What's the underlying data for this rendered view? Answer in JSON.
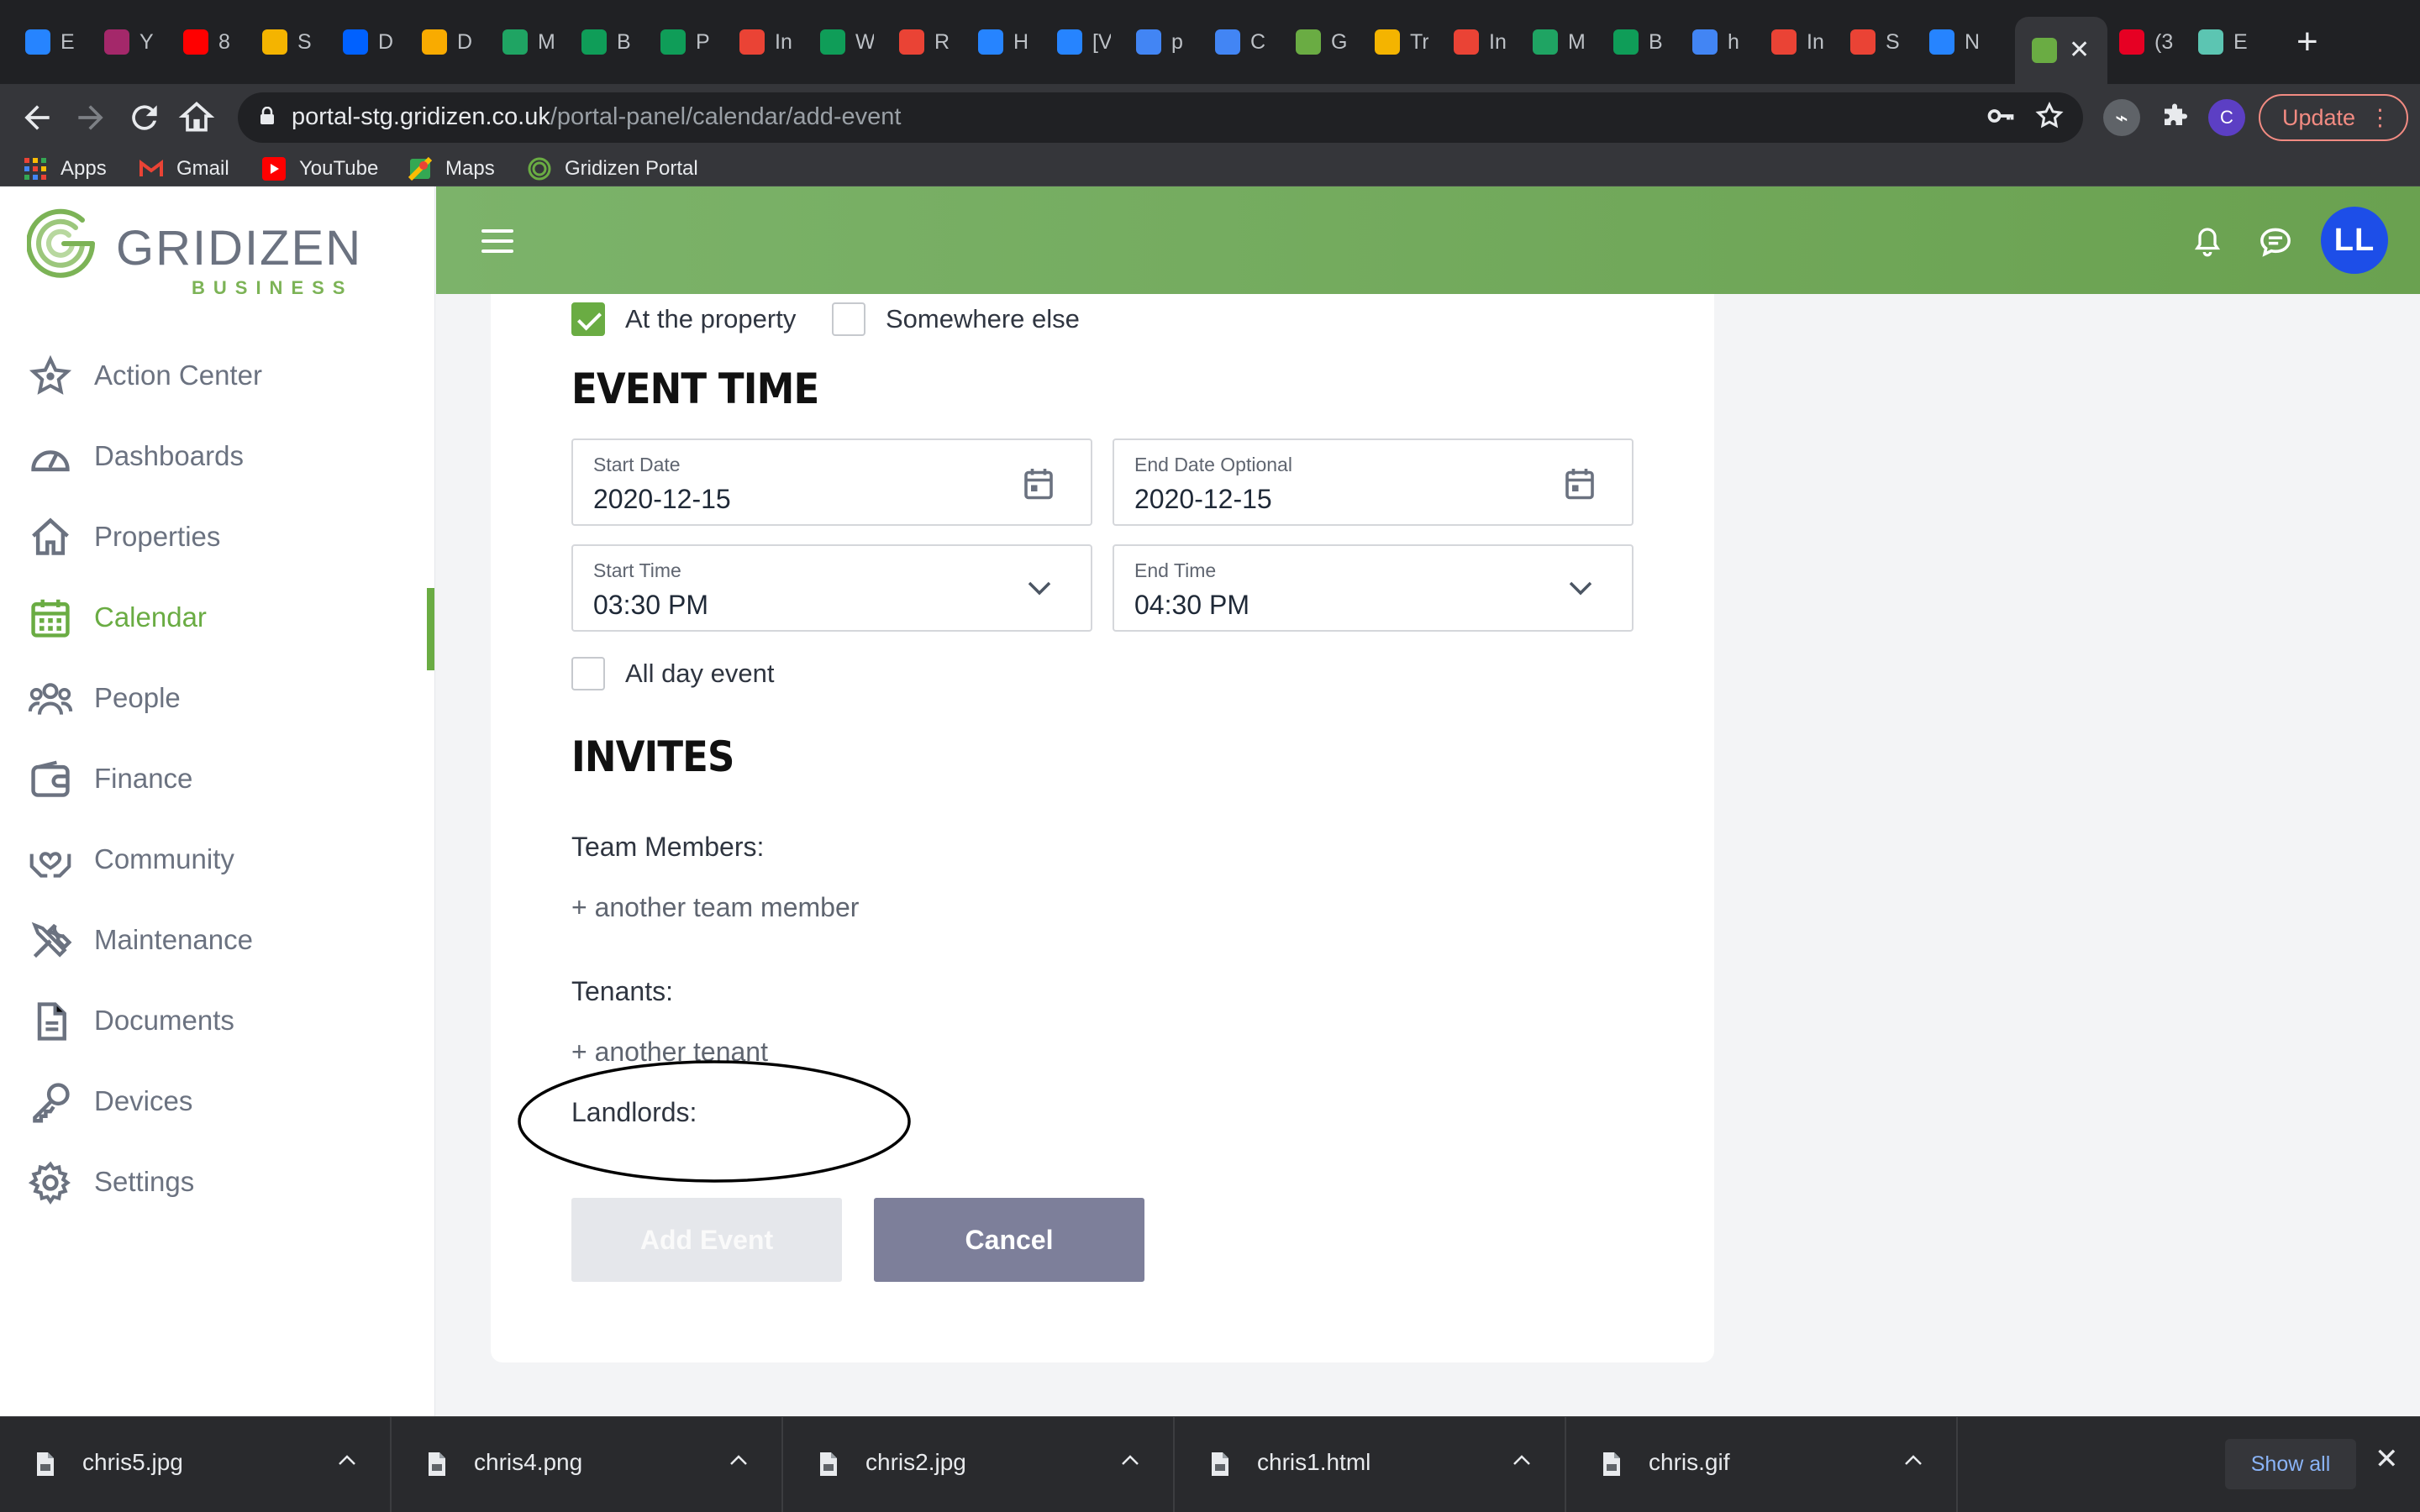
{
  "browser": {
    "tabs": [
      {
        "letter": "E",
        "icon": "jira-icon",
        "color": "#2684ff"
      },
      {
        "letter": "Y",
        "icon": "yoast-icon",
        "color": "#a4286a"
      },
      {
        "letter": "8",
        "icon": "youtube-icon",
        "color": "#ff0000"
      },
      {
        "letter": "S",
        "icon": "app-icon",
        "color": "#f4b400"
      },
      {
        "letter": "D",
        "icon": "dropbox-icon",
        "color": "#0061ff"
      },
      {
        "letter": "D",
        "icon": "app-icon",
        "color": "#f9ab00"
      },
      {
        "letter": "M",
        "icon": "drive-icon",
        "color": "#1fa463"
      },
      {
        "letter": "B",
        "icon": "sheets-icon",
        "color": "#0f9d58"
      },
      {
        "letter": "P",
        "icon": "sheets-icon",
        "color": "#0f9d58"
      },
      {
        "letter": "In",
        "icon": "gmail-icon",
        "color": "#ea4335"
      },
      {
        "letter": "W",
        "icon": "sheets-icon",
        "color": "#0f9d58"
      },
      {
        "letter": "R",
        "icon": "gmail-icon",
        "color": "#ea4335"
      },
      {
        "letter": "H",
        "icon": "confluence-icon",
        "color": "#2684ff"
      },
      {
        "letter": "[V",
        "icon": "jira-icon",
        "color": "#2684ff"
      },
      {
        "letter": "p",
        "icon": "google-icon",
        "color": "#4285f4"
      },
      {
        "letter": "C",
        "icon": "app-icon",
        "color": "#4285f4"
      },
      {
        "letter": "G",
        "icon": "gridizen-icon",
        "color": "#6aac43"
      },
      {
        "letter": "Tr",
        "icon": "app-icon",
        "color": "#f4b400"
      },
      {
        "letter": "In",
        "icon": "gmail-icon",
        "color": "#ea4335"
      },
      {
        "letter": "M",
        "icon": "drive-icon",
        "color": "#1fa463"
      },
      {
        "letter": "B",
        "icon": "sheets-icon",
        "color": "#0f9d58"
      },
      {
        "letter": "h",
        "icon": "google-icon",
        "color": "#4285f4"
      },
      {
        "letter": "In",
        "icon": "gmail-icon",
        "color": "#ea4335"
      },
      {
        "letter": "S",
        "icon": "gmail-icon",
        "color": "#ea4335"
      },
      {
        "letter": "N",
        "icon": "confluence-icon",
        "color": "#2684ff"
      },
      {
        "letter": "",
        "icon": "gridizen-icon",
        "color": "#6aac43",
        "active": true
      },
      {
        "letter": "(3",
        "icon": "pinterest-icon",
        "color": "#e60023"
      },
      {
        "letter": "E",
        "icon": "app-icon",
        "color": "#5cc5b2"
      }
    ],
    "url_domain": "portal-stg.gridizen.co.uk",
    "url_path": "/portal-panel/calendar/add-event",
    "profile_letter": "C",
    "update_label": "Update",
    "bookmarks": [
      {
        "label": "Apps",
        "icon": "apps-grid-icon"
      },
      {
        "label": "Gmail",
        "icon": "gmail-icon"
      },
      {
        "label": "YouTube",
        "icon": "youtube-icon"
      },
      {
        "label": "Maps",
        "icon": "maps-icon"
      },
      {
        "label": "Gridizen Portal",
        "icon": "gridizen-icon"
      }
    ]
  },
  "brand": {
    "name": "GRIDIZEN",
    "sub": "BUSINESS",
    "accent": "#6aac43",
    "header_color": "#7cb36a"
  },
  "sidebar": {
    "items": [
      {
        "label": "Action Center",
        "icon": "star-icon"
      },
      {
        "label": "Dashboards",
        "icon": "gauge-icon"
      },
      {
        "label": "Properties",
        "icon": "house-icon"
      },
      {
        "label": "Calendar",
        "icon": "calendar-icon",
        "active": true
      },
      {
        "label": "People",
        "icon": "people-icon"
      },
      {
        "label": "Finance",
        "icon": "wallet-icon"
      },
      {
        "label": "Community",
        "icon": "heart-hands-icon"
      },
      {
        "label": "Maintenance",
        "icon": "tools-icon"
      },
      {
        "label": "Documents",
        "icon": "document-icon"
      },
      {
        "label": "Devices",
        "icon": "key-icon"
      },
      {
        "label": "Settings",
        "icon": "gear-icon"
      }
    ]
  },
  "header": {
    "avatar_initials": "LL"
  },
  "form": {
    "location_options": [
      {
        "label": "At the property",
        "checked": true
      },
      {
        "label": "Somewhere else",
        "checked": false
      }
    ],
    "event_time_title": "EVENT TIME",
    "start_date": {
      "label": "Start Date",
      "value": "2020-12-15"
    },
    "end_date": {
      "label": "End Date Optional",
      "value": "2020-12-15"
    },
    "start_time": {
      "label": "Start Time",
      "value": "03:30 PM"
    },
    "end_time": {
      "label": "End Time",
      "value": "04:30 PM"
    },
    "all_day": {
      "label": "All day event",
      "checked": false
    },
    "invites_title": "INVITES",
    "team_members_label": "Team Members:",
    "add_team_member": "+ another team member",
    "tenants_label": "Tenants:",
    "add_tenant": "+ another tenant",
    "landlords_label": "Landlords:",
    "add_event_label": "Add Event",
    "cancel_label": "Cancel"
  },
  "downloads": {
    "items": [
      {
        "name": "chris5.jpg"
      },
      {
        "name": "chris4.png"
      },
      {
        "name": "chris2.jpg"
      },
      {
        "name": "chris1.html"
      },
      {
        "name": "chris.gif"
      }
    ],
    "show_all_label": "Show all"
  }
}
